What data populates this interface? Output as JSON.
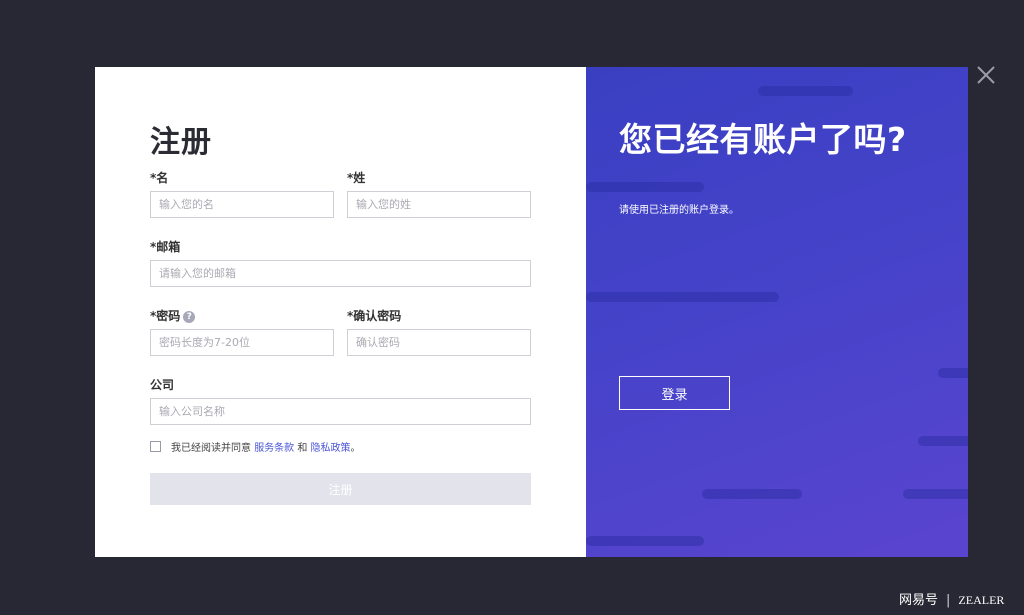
{
  "register": {
    "title": "注册",
    "first_name": {
      "label": "*名",
      "placeholder": "输入您的名"
    },
    "last_name": {
      "label": "*姓",
      "placeholder": "输入您的姓"
    },
    "email": {
      "label": "*邮箱",
      "placeholder": "请输入您的邮箱"
    },
    "password": {
      "label": "*密码",
      "placeholder": "密码长度为7-20位",
      "help_icon": "?"
    },
    "confirm_password": {
      "label": "*确认密码",
      "placeholder": "确认密码"
    },
    "company": {
      "label": "公司",
      "placeholder": "输入公司名称"
    },
    "agreement": {
      "text_before": "我已经阅读并同意 ",
      "terms_link": "服务条款",
      "text_middle": " 和 ",
      "privacy_link": "隐私政策",
      "text_after": "。"
    },
    "submit_label": "注册"
  },
  "login_panel": {
    "title": "您已经有账户了吗?",
    "subtitle": "请使用已注册的账户登录。",
    "login_label": "登录"
  },
  "watermark": {
    "source": "网易号",
    "separator": "|",
    "brand": "ZEALER"
  },
  "colors": {
    "backdrop": "#272833",
    "panel_gradient_start": "#3a3fc2",
    "panel_gradient_end": "#5a44cf",
    "link": "#4a55d6",
    "submit_disabled": "#e3e3ec"
  }
}
